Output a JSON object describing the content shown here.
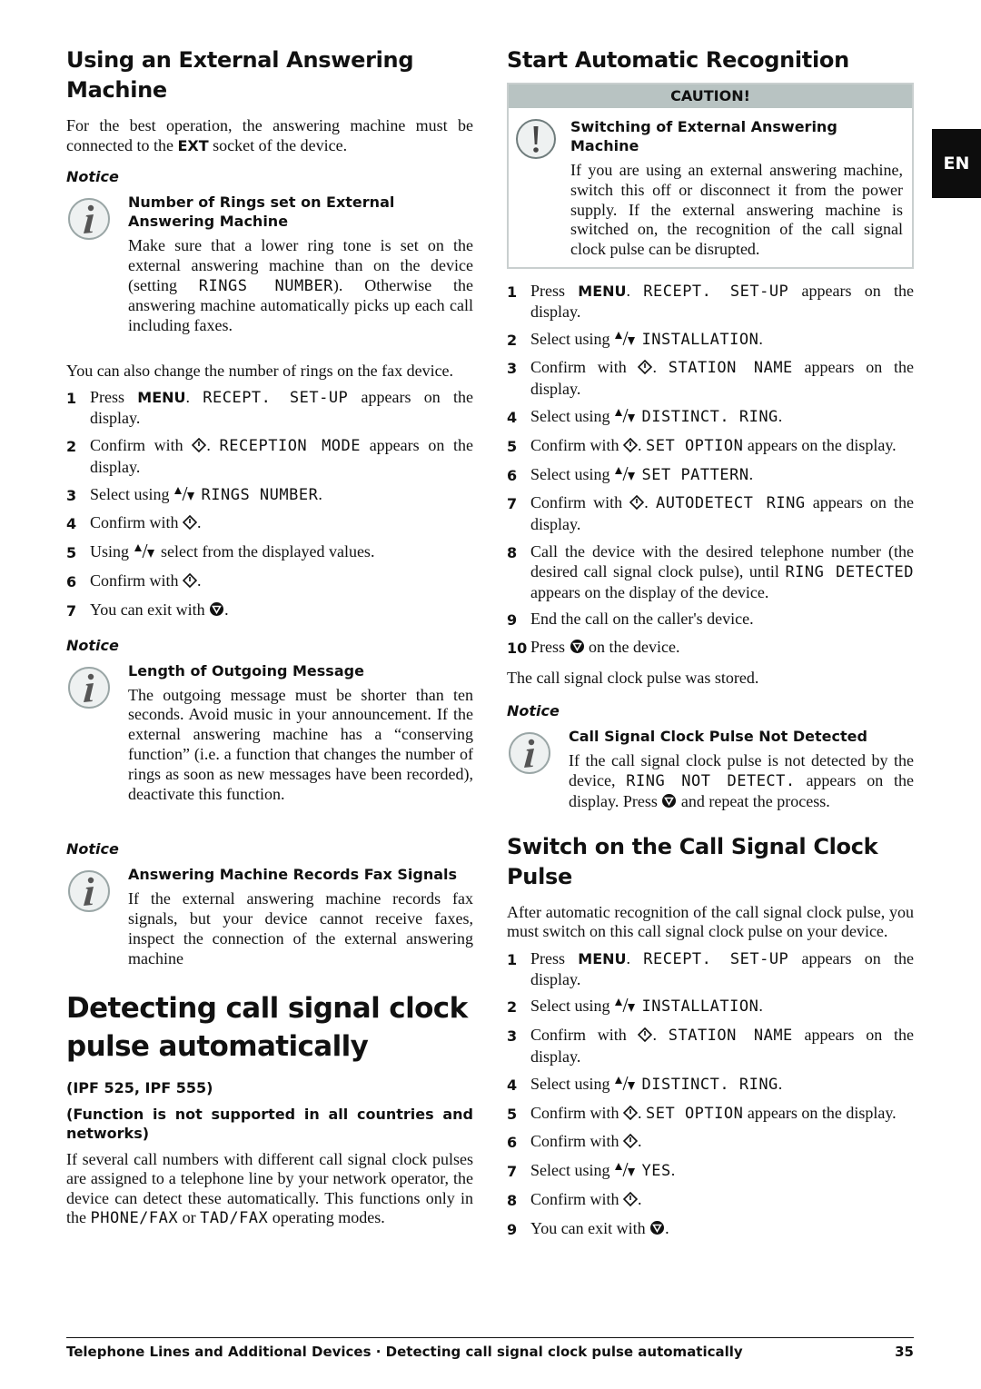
{
  "lang_tab": "EN",
  "left": {
    "section1": {
      "title": "Using an External Answering Machine",
      "intro_pre": "For the best operation, the answering machine must be connected to the ",
      "intro_key": "EXT",
      "intro_post": " socket of the device.",
      "notice1": {
        "label": "Notice",
        "icon": "info-icon",
        "title": "Number of Rings set on External Answering Machine",
        "text_pre": "Make sure that a lower ring tone is set on the external answering machine than on the device (setting ",
        "text_lcd": "RINGS NUMBER",
        "text_post": "). Otherwise the answering machine automatically picks up each call including faxes."
      },
      "para2": "You can also change the number of rings on the fax device.",
      "steps": [
        {
          "n": "1",
          "pre": "Press ",
          "key": "MENU",
          "mid": ". ",
          "lcd": "RECEPT. SET-UP",
          "post": " appears on the display."
        },
        {
          "n": "2",
          "pre": "Confirm with ",
          "icon": "ok-diamond-icon",
          "mid": ". ",
          "lcd": "RECEPTION MODE",
          "post": " appears on the display."
        },
        {
          "n": "3",
          "pre": "Select using ",
          "icon": "up-down-arrows-icon",
          "mid": " ",
          "lcd": "RINGS NUMBER",
          "post": "."
        },
        {
          "n": "4",
          "pre": "Confirm with ",
          "icon": "ok-diamond-icon",
          "post": "."
        },
        {
          "n": "5",
          "pre": "Using ",
          "icon": "up-down-arrows-icon",
          "post": " select from the displayed values."
        },
        {
          "n": "6",
          "pre": "Confirm with ",
          "icon": "ok-diamond-icon",
          "post": "."
        },
        {
          "n": "7",
          "pre": "You can exit with ",
          "icon": "stop-icon",
          "post": "."
        }
      ],
      "notice2": {
        "label": "Notice",
        "icon": "info-icon",
        "title": "Length of Outgoing Message",
        "text": "The outgoing message must be shorter than ten seconds. Avoid music in your announcement. If the external answering machine has a “conserving function” (i.e. a function that changes the number of rings as soon as new messages have been recorded), deactivate this function."
      },
      "notice3": {
        "label": "Notice",
        "icon": "info-icon",
        "title": "Answering Machine Records Fax Signals",
        "text": "If the external answering machine records fax signals, but your device cannot receive faxes, inspect the connection of the external answering machine"
      }
    },
    "section2": {
      "title": "Detecting call signal clock pulse automatically",
      "models": "(IPF 525, IPF 555)",
      "support_note": "(Function is not supported in all countries and networks)",
      "para_pre": "If several call numbers with different call signal clock pulses are assigned to a telephone line by your network operator, the device can detect these automatically. This functions only in the ",
      "para_lcd1": "PHONE/FAX",
      "para_mid": " or ",
      "para_lcd2": "TAD/FAX",
      "para_post": " operating modes."
    }
  },
  "right": {
    "section1": {
      "title": "Start Automatic Recognition",
      "caution": {
        "header": "CAUTION!",
        "icon": "exclamation-icon",
        "title": "Switching of External Answering Machine",
        "text": "If you are using an external answering machine, switch this off or disconnect it from the power supply. If the external answering machine is switched on, the recognition of the call signal clock pulse can be disrupted."
      },
      "steps": [
        {
          "n": "1",
          "pre": "Press ",
          "key": "MENU",
          "mid": ". ",
          "lcd": "RECEPT. SET-UP",
          "post": " appears on the display."
        },
        {
          "n": "2",
          "pre": "Select using ",
          "icon": "up-down-arrows-icon",
          "mid": " ",
          "lcd": "INSTALLATION",
          "post": "."
        },
        {
          "n": "3",
          "pre": "Confirm with ",
          "icon": "ok-diamond-icon",
          "mid": ". ",
          "lcd": "STATION NAME",
          "post": " appears on the display."
        },
        {
          "n": "4",
          "pre": "Select using ",
          "icon": "up-down-arrows-icon",
          "mid": " ",
          "lcd": "DISTINCT. RING",
          "post": "."
        },
        {
          "n": "5",
          "pre": "Confirm with ",
          "icon": "ok-diamond-icon",
          "mid": ". ",
          "lcd": "SET OPTION",
          "post": " appears on the display."
        },
        {
          "n": "6",
          "pre": "Select using ",
          "icon": "up-down-arrows-icon",
          "mid": " ",
          "lcd": "SET PATTERN",
          "post": "."
        },
        {
          "n": "7",
          "pre": "Confirm with ",
          "icon": "ok-diamond-icon",
          "mid": ". ",
          "lcd": "AUTODETECT RING",
          "post": " appears on the display."
        },
        {
          "n": "8",
          "pre": "Call the device with the desired telephone number (the desired call signal clock pulse), until ",
          "lcd": "RING DETECTED",
          "post": " appears on the display of the device."
        },
        {
          "n": "9",
          "pre": "End the call on the caller's device."
        },
        {
          "n": "10",
          "pre": "Press ",
          "icon": "stop-icon",
          "post": " on the device."
        }
      ],
      "stored_note": "The call signal clock pulse was stored.",
      "notice": {
        "label": "Notice",
        "icon": "info-icon",
        "title": "Call Signal Clock Pulse Not Detected",
        "text_pre": "If the call signal clock pulse is not detected by the device, ",
        "text_lcd": "RING NOT DETECT.",
        "text_mid": " appears on the display. Press ",
        "text_icon": "stop-icon",
        "text_post": " and repeat the process."
      }
    },
    "section2": {
      "title": "Switch on the Call Signal Clock Pulse",
      "intro": "After automatic recognition of the call signal clock pulse, you must switch on this call signal clock pulse on your device.",
      "steps": [
        {
          "n": "1",
          "pre": "Press ",
          "key": "MENU",
          "mid": ". ",
          "lcd": "RECEPT. SET-UP",
          "post": " appears on the display."
        },
        {
          "n": "2",
          "pre": "Select using ",
          "icon": "up-down-arrows-icon",
          "mid": " ",
          "lcd": "INSTALLATION",
          "post": "."
        },
        {
          "n": "3",
          "pre": "Confirm with ",
          "icon": "ok-diamond-icon",
          "mid": ". ",
          "lcd": "STATION NAME",
          "post": " appears on the display."
        },
        {
          "n": "4",
          "pre": "Select using ",
          "icon": "up-down-arrows-icon",
          "mid": " ",
          "lcd": "DISTINCT. RING",
          "post": "."
        },
        {
          "n": "5",
          "pre": "Confirm with ",
          "icon": "ok-diamond-icon",
          "mid": ". ",
          "lcd": "SET OPTION",
          "post": " appears on the display."
        },
        {
          "n": "6",
          "pre": "Confirm with ",
          "icon": "ok-diamond-icon",
          "post": "."
        },
        {
          "n": "7",
          "pre": "Select using ",
          "icon": "up-down-arrows-icon",
          "mid": " ",
          "lcd": "YES",
          "post": "."
        },
        {
          "n": "8",
          "pre": "Confirm with ",
          "icon": "ok-diamond-icon",
          "post": "."
        },
        {
          "n": "9",
          "pre": "You can exit with ",
          "icon": "stop-icon",
          "post": "."
        }
      ]
    }
  },
  "footer": {
    "text": "Telephone Lines and Additional Devices · Detecting call signal clock pulse automatically",
    "page_number": "35"
  }
}
